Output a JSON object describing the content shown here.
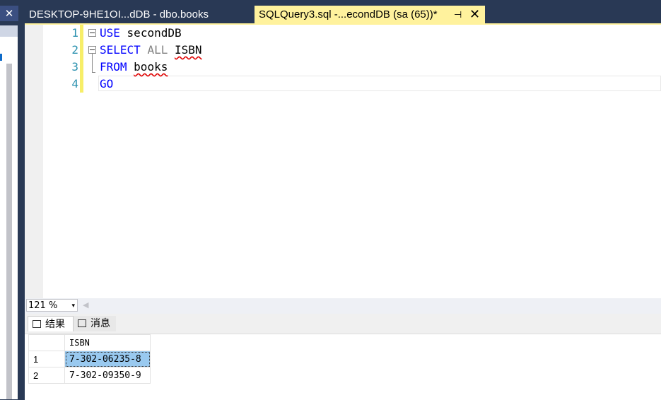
{
  "left_panel": {
    "close_glyph": "✕"
  },
  "tabs": [
    {
      "label": "DESKTOP-9HE1OI...dDB - dbo.books",
      "active": false
    },
    {
      "label": "SQLQuery3.sql -...econdDB (sa (65))*",
      "active": true,
      "pin_glyph": "⊣",
      "close_glyph": "✕"
    }
  ],
  "editor": {
    "line_numbers": [
      "1",
      "2",
      "3",
      "4"
    ],
    "lines": [
      {
        "kw": "USE",
        "rest": "secondDB"
      },
      {
        "kw": "SELECT",
        "mod": "ALL",
        "rest": "ISBN"
      },
      {
        "kw": "FROM",
        "rest": "books"
      },
      {
        "kw": "GO"
      }
    ]
  },
  "zoom": {
    "value": "121 %",
    "arrow": "▾",
    "scroll_left": "◀"
  },
  "results_tabs": [
    {
      "label": "结果",
      "icon": "grid-icon"
    },
    {
      "label": "消息",
      "icon": "messages-icon"
    }
  ],
  "results": {
    "columns": [
      "ISBN"
    ],
    "rows": [
      {
        "n": "1",
        "isbn": "7-302-06235-8"
      },
      {
        "n": "2",
        "isbn": "7-302-09350-9"
      }
    ]
  },
  "colors": {
    "chrome": "#293955",
    "active_tab": "#fff29d",
    "keyword": "#0000ff",
    "line_number": "#2b91af",
    "selected_cell": "#99c9ef"
  }
}
